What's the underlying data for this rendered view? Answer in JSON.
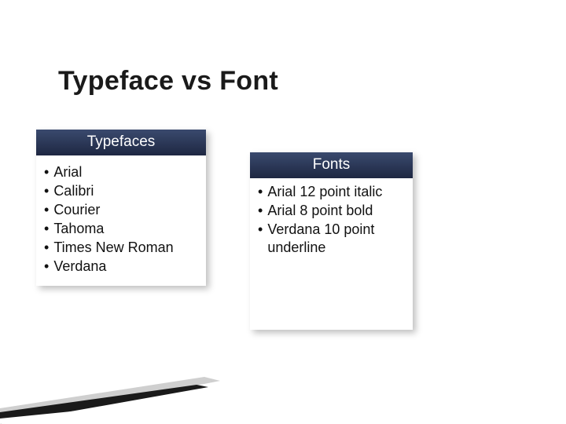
{
  "title": "Typeface vs Font",
  "left": {
    "header": "Typefaces",
    "items": [
      "Arial",
      "Calibri",
      "Courier",
      "Tahoma",
      "Times New Roman",
      "Verdana"
    ]
  },
  "right": {
    "header": "Fonts",
    "items": [
      "Arial 12 point italic",
      "Arial 8 point bold",
      "Verdana 10 point underline"
    ]
  }
}
